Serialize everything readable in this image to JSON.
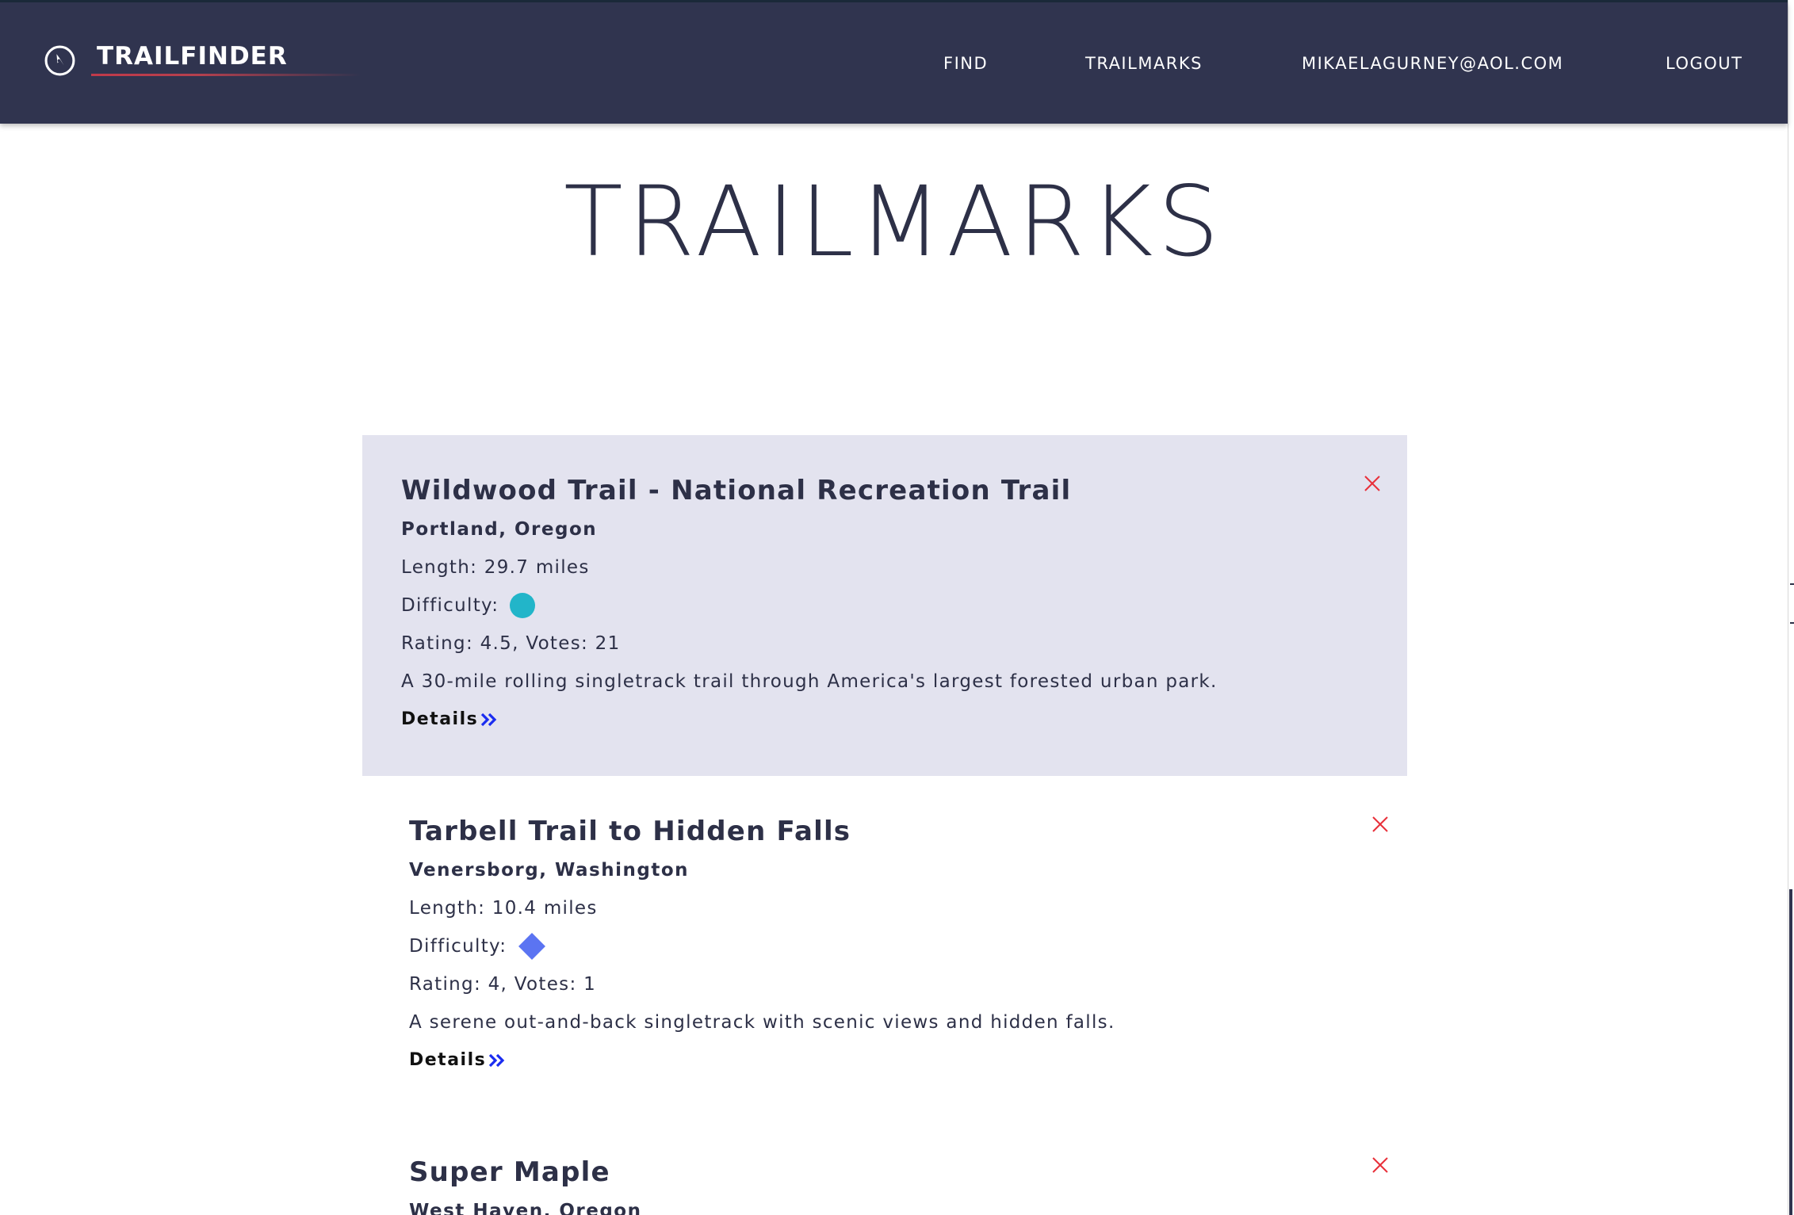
{
  "header": {
    "app_name": "TRAILFINDER",
    "logo_icon": "compass-icon",
    "nav": [
      {
        "label": "FIND"
      },
      {
        "label": "TRAILMARKS"
      },
      {
        "label": "MIKAELAGURNEY@AOL.COM"
      },
      {
        "label": "LOGOUT"
      }
    ]
  },
  "page": {
    "title": "TRAILMARKS"
  },
  "trails": [
    {
      "name": "Wildwood Trail - National Recreation Trail",
      "location": "Portland, Oregon",
      "length": "Length: 29.7 miles",
      "difficulty_label": "Difficulty:",
      "difficulty_icon": "teal-circle-icon",
      "rating": "Rating: 4.5, Votes: 21",
      "summary": "A 30-mile rolling singletrack trail through America's largest forested urban park.",
      "details_label": "Details"
    },
    {
      "name": "Tarbell Trail to Hidden Falls",
      "location": "Venersborg, Washington",
      "length": "Length: 10.4 miles",
      "difficulty_label": "Difficulty:",
      "difficulty_icon": "blue-diamond-icon",
      "rating": "Rating: 4, Votes: 1",
      "summary": "A serene out-and-back singletrack with scenic views and hidden falls.",
      "details_label": "Details"
    },
    {
      "name": "Super Maple",
      "location": "West Haven, Oregon"
    }
  ],
  "colors": {
    "header_bg": "#30344f",
    "text": "#2d3047",
    "highlight_card": "#e3e3ef",
    "brand_underline": "#c13a4a",
    "close_icon": "#e8303a",
    "chevron": "#1a2cf0",
    "difficulty_teal": "#22b5c9",
    "difficulty_blue": "#5b74f2"
  }
}
